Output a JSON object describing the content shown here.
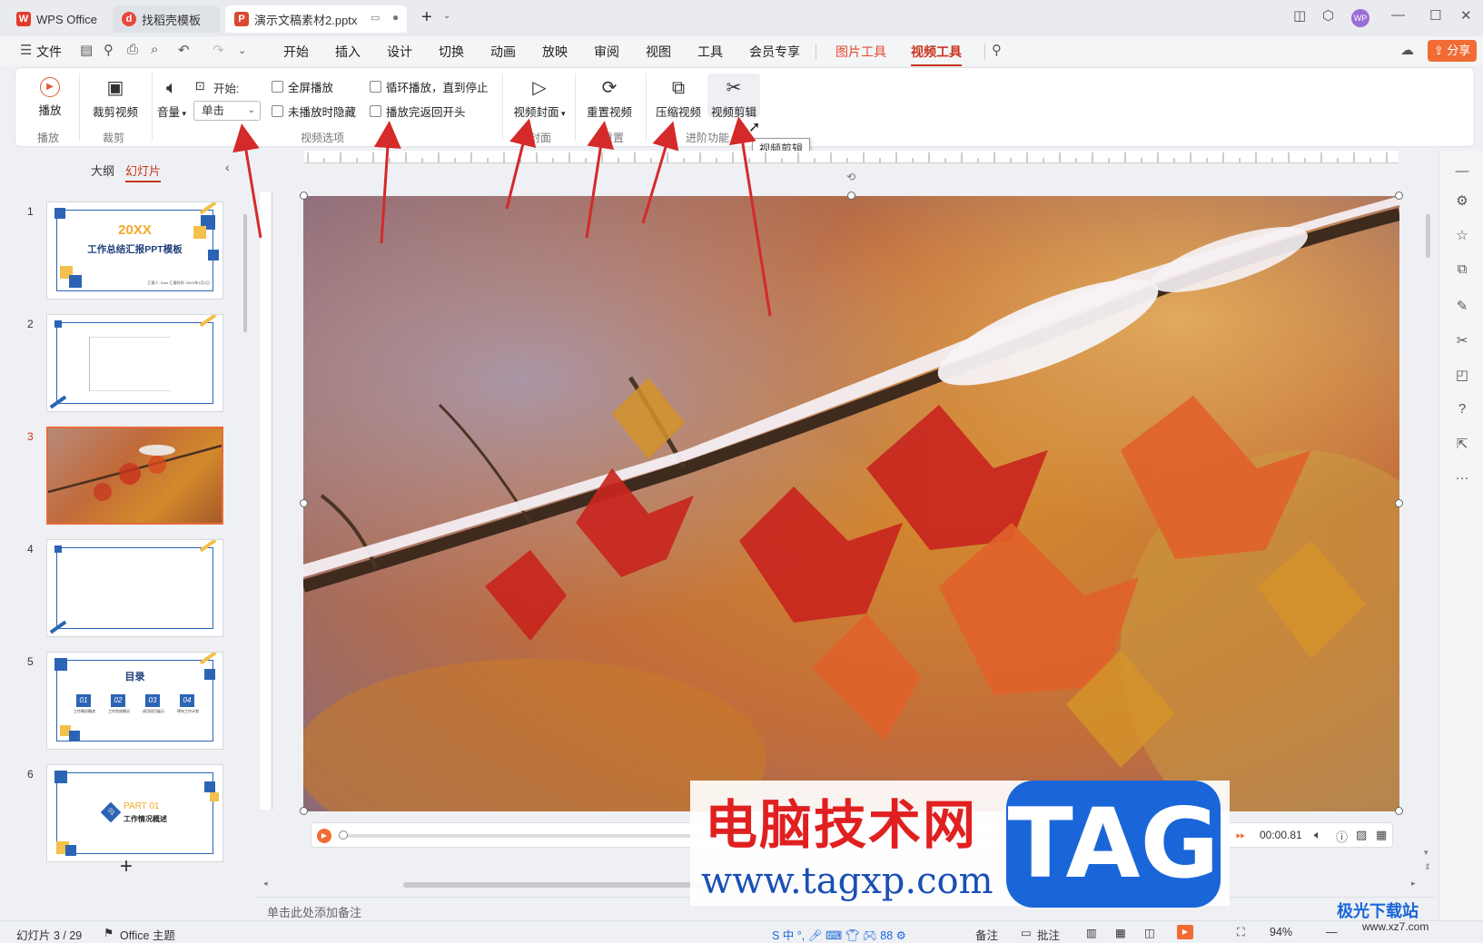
{
  "titlebar": {
    "tabs": [
      {
        "label": "WPS Office"
      },
      {
        "label": "找稻壳模板"
      },
      {
        "label": "演示文稿素材2.pptx"
      }
    ],
    "new_tab": "+",
    "avatar": "WP"
  },
  "menubar": {
    "file": "文件",
    "items": [
      "开始",
      "插入",
      "设计",
      "切换",
      "动画",
      "放映",
      "审阅",
      "视图",
      "工具",
      "会员专享",
      "图片工具",
      "视频工具"
    ],
    "share": "分享"
  },
  "ribbon": {
    "play": {
      "label": "播放",
      "group": "播放"
    },
    "trim": {
      "label": "裁剪视频",
      "group": "裁剪"
    },
    "volume": {
      "label": "音量"
    },
    "start_label": "开始:",
    "start_value": "单击",
    "checks": [
      "全屏播放",
      "未播放时隐藏",
      "循环播放，直到停止",
      "播放完返回开头"
    ],
    "options_group": "视频选项",
    "cover": {
      "label": "视频封面",
      "group": "封面"
    },
    "reset": {
      "label": "重置视频",
      "group": "重置"
    },
    "compress": {
      "label": "压缩视频"
    },
    "edit": {
      "label": "视频剪辑"
    },
    "advanced_group": "进阶功能",
    "tooltip": "视频剪辑"
  },
  "leftpanel": {
    "tabs": [
      "大纲",
      "幻灯片"
    ],
    "slides": [
      {
        "num": "1",
        "title": "20XX",
        "subtitle": "工作总结汇报PPT模板",
        "caption": "汇报人: Xxxx 汇报时间: 20XX年1月1日"
      },
      {
        "num": "2"
      },
      {
        "num": "3"
      },
      {
        "num": "4"
      },
      {
        "num": "5",
        "title": "目录",
        "items": [
          "01",
          "02",
          "03",
          "04"
        ],
        "captions": [
          "工作情况概述",
          "工作完成情况",
          "成功项目展示",
          "明年工作计划"
        ]
      },
      {
        "num": "6",
        "title": "PART 01",
        "subtitle": "工作情况概述",
        "badge": "01"
      }
    ],
    "add": "+"
  },
  "player": {
    "time": "00:00.81"
  },
  "notes": {
    "placeholder": "单击此处添加备注"
  },
  "statusbar": {
    "slide_count": "幻灯片 3 / 29",
    "theme": "Office 主题",
    "comment1": "备注",
    "comment2": "批注",
    "zoom": "94%"
  },
  "watermarks": {
    "cn": "电脑技术网",
    "url": "www.tagxp.com",
    "tag": "TAG",
    "xz": "极光下载站",
    "xz_url": "www.xz7.com"
  },
  "colors": {
    "accent": "#c8361e",
    "arrow": "#d42a2a",
    "slide_blue": "#2c64b5",
    "slide_gold": "#f3c04b"
  }
}
